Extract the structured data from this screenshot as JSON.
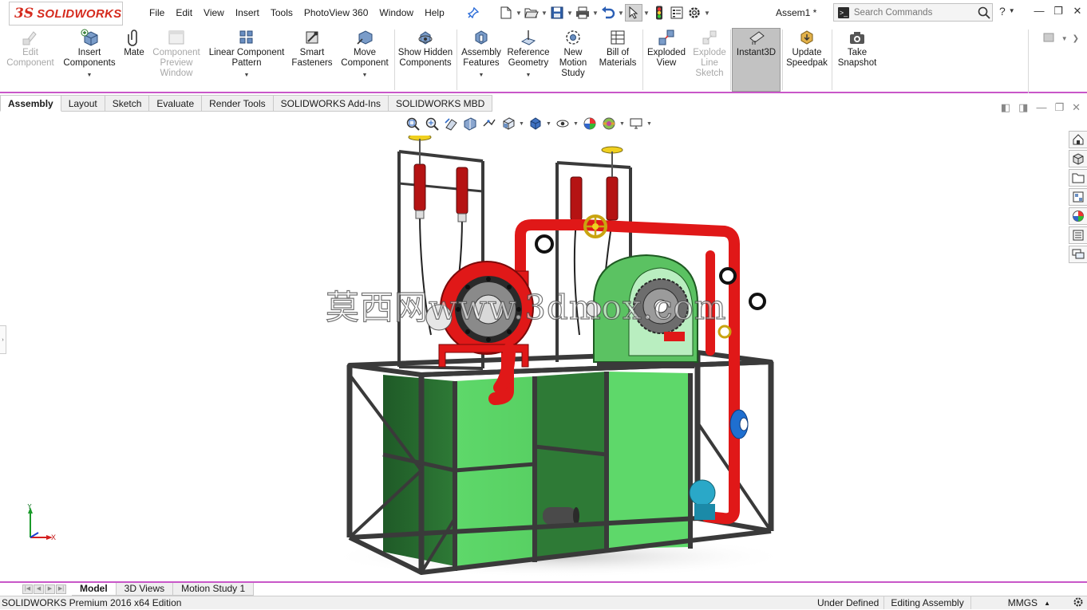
{
  "app": {
    "logo_ds": "3S",
    "logo_text": "SOLIDWORKS",
    "document_title": "Assem1 *"
  },
  "menu": [
    "File",
    "Edit",
    "View",
    "Insert",
    "Tools",
    "PhotoView 360",
    "Window",
    "Help"
  ],
  "search": {
    "placeholder": "Search Commands"
  },
  "help_label": "?",
  "ribbon": {
    "edit_component": "Edit Component",
    "insert_components": "Insert Components",
    "mate": "Mate",
    "component_preview": "Component Preview Window",
    "linear_pattern": "Linear Component Pattern",
    "smart_fasteners": "Smart Fasteners",
    "move_component": "Move Component",
    "show_hidden": "Show Hidden Components",
    "assembly_features": "Assembly Features",
    "reference_geometry": "Reference Geometry",
    "new_motion_study": "New Motion Study",
    "bill_of_materials": "Bill of Materials",
    "exploded_view": "Exploded View",
    "explode_line_sketch": "Explode Line Sketch",
    "instant3d": "Instant3D",
    "update_speedpak": "Update Speedpak",
    "take_snapshot": "Take Snapshot"
  },
  "command_tabs": [
    {
      "label": "Assembly",
      "active": true
    },
    {
      "label": "Layout"
    },
    {
      "label": "Sketch"
    },
    {
      "label": "Evaluate"
    },
    {
      "label": "Render Tools"
    },
    {
      "label": "SOLIDWORKS Add-Ins"
    },
    {
      "label": "SOLIDWORKS MBD"
    }
  ],
  "triad": {
    "y": "Y",
    "x": "X"
  },
  "watermark": "莫西网www.3dmox.com",
  "bottom_tabs": [
    {
      "label": "Model",
      "active": true
    },
    {
      "label": "3D Views"
    },
    {
      "label": "Motion Study 1"
    }
  ],
  "status": {
    "product": "SOLIDWORKS Premium 2016 x64 Edition",
    "definition": "Under Defined",
    "mode": "Editing Assembly",
    "units": "MMGS",
    "units_arrow": "▲"
  },
  "colors": {
    "accent_line": "#c857c8",
    "frame": "#3a3a3a",
    "tank": "#5ed86a",
    "pipe": "#e01818",
    "valve_yellow": "#f0d020",
    "pump_blue": "#1f6fd0"
  }
}
